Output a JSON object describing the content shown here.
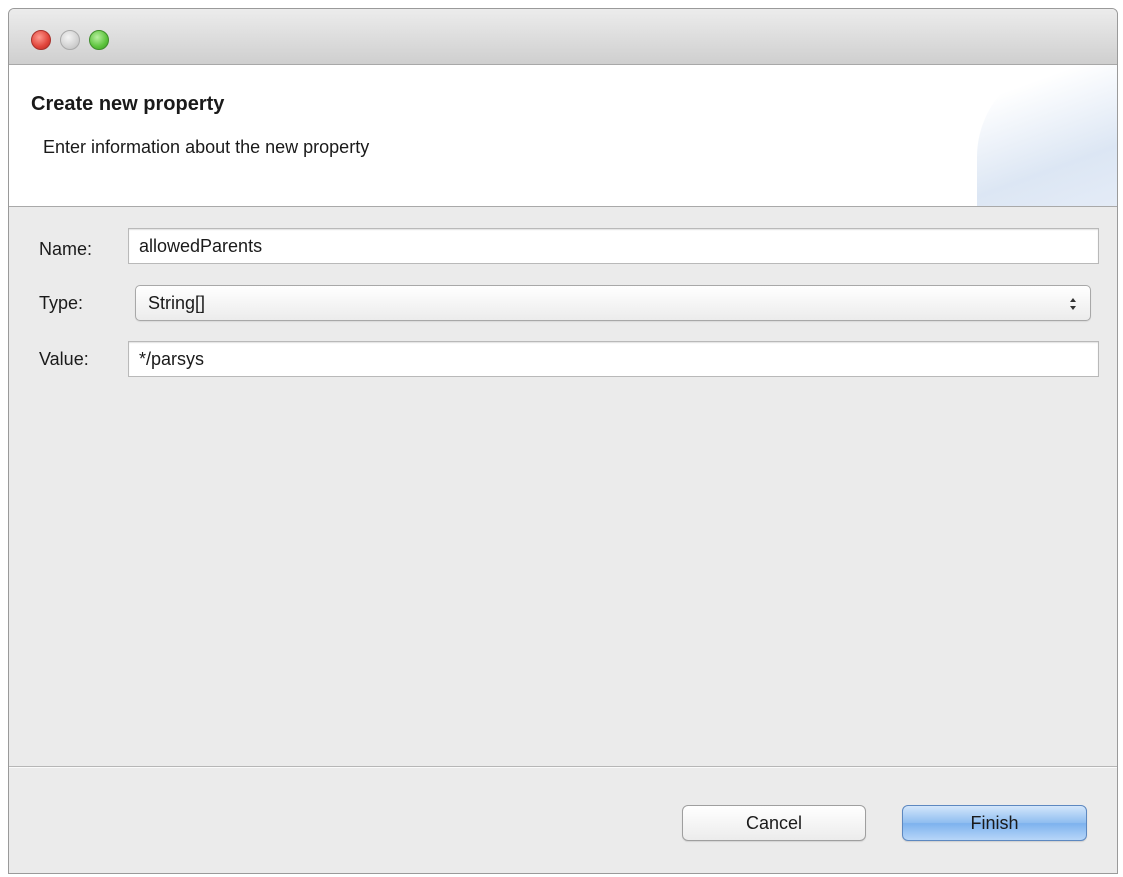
{
  "window": {
    "controls": [
      "close",
      "minimize",
      "zoom"
    ]
  },
  "header": {
    "title": "Create new property",
    "description": "Enter information about the new property"
  },
  "form": {
    "name": {
      "label": "Name:",
      "value": "allowedParents"
    },
    "type": {
      "label": "Type:",
      "value": "String[]"
    },
    "value": {
      "label": "Value:",
      "value": "*/parsys"
    }
  },
  "buttons": {
    "cancel": "Cancel",
    "finish": "Finish"
  },
  "colors": {
    "close": "#e0443a",
    "minimize": "#d2d2d2",
    "zoom": "#5cc33c",
    "default_button": "#8fbdf0"
  }
}
